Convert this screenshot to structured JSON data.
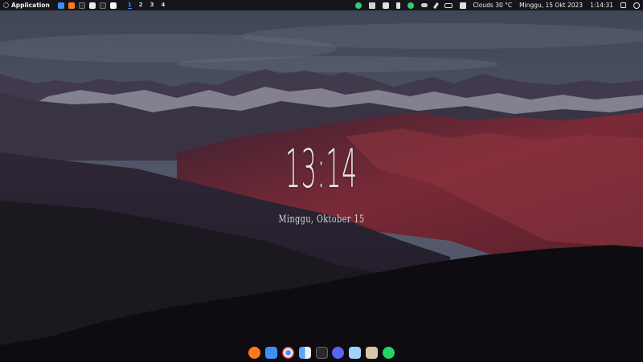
{
  "topbar": {
    "app_menu_label": "Application",
    "workspaces": [
      "1",
      "2",
      "3",
      "4"
    ],
    "active_workspace": "1",
    "weather": "Clouds 30 °C",
    "date": "Minggu, 15 Okt 2023",
    "time": "1:14:31",
    "task_icons": [
      "files-icon",
      "firefox-icon",
      "terminal-icon",
      "chrome-icon",
      "terminal-icon",
      "document-icon"
    ],
    "tray_icons": [
      "update-icon",
      "bolt-icon",
      "discord-icon",
      "music-icon",
      "whatsapp-icon",
      "cloud-icon",
      "pen-icon",
      "network-icon",
      "volume-icon"
    ]
  },
  "desktop": {
    "clock": "13:14",
    "date": "Minggu, Oktober 15"
  },
  "dock": {
    "items": [
      {
        "name": "firefox-icon",
        "color": "#ff7a1a"
      },
      {
        "name": "files-icon",
        "color": "#3f8ff0"
      },
      {
        "name": "chrome-icon",
        "color": "#e9e9e9"
      },
      {
        "name": "finder-icon",
        "color": "#5aa8f5"
      },
      {
        "name": "terminal-icon",
        "color": "#2a2a2e"
      },
      {
        "name": "discord-icon",
        "color": "#5865f2"
      },
      {
        "name": "settings-icon",
        "color": "#9fd3f7"
      },
      {
        "name": "gimp-icon",
        "color": "#d6c7a8"
      },
      {
        "name": "whatsapp-icon",
        "color": "#25d366"
      }
    ]
  }
}
